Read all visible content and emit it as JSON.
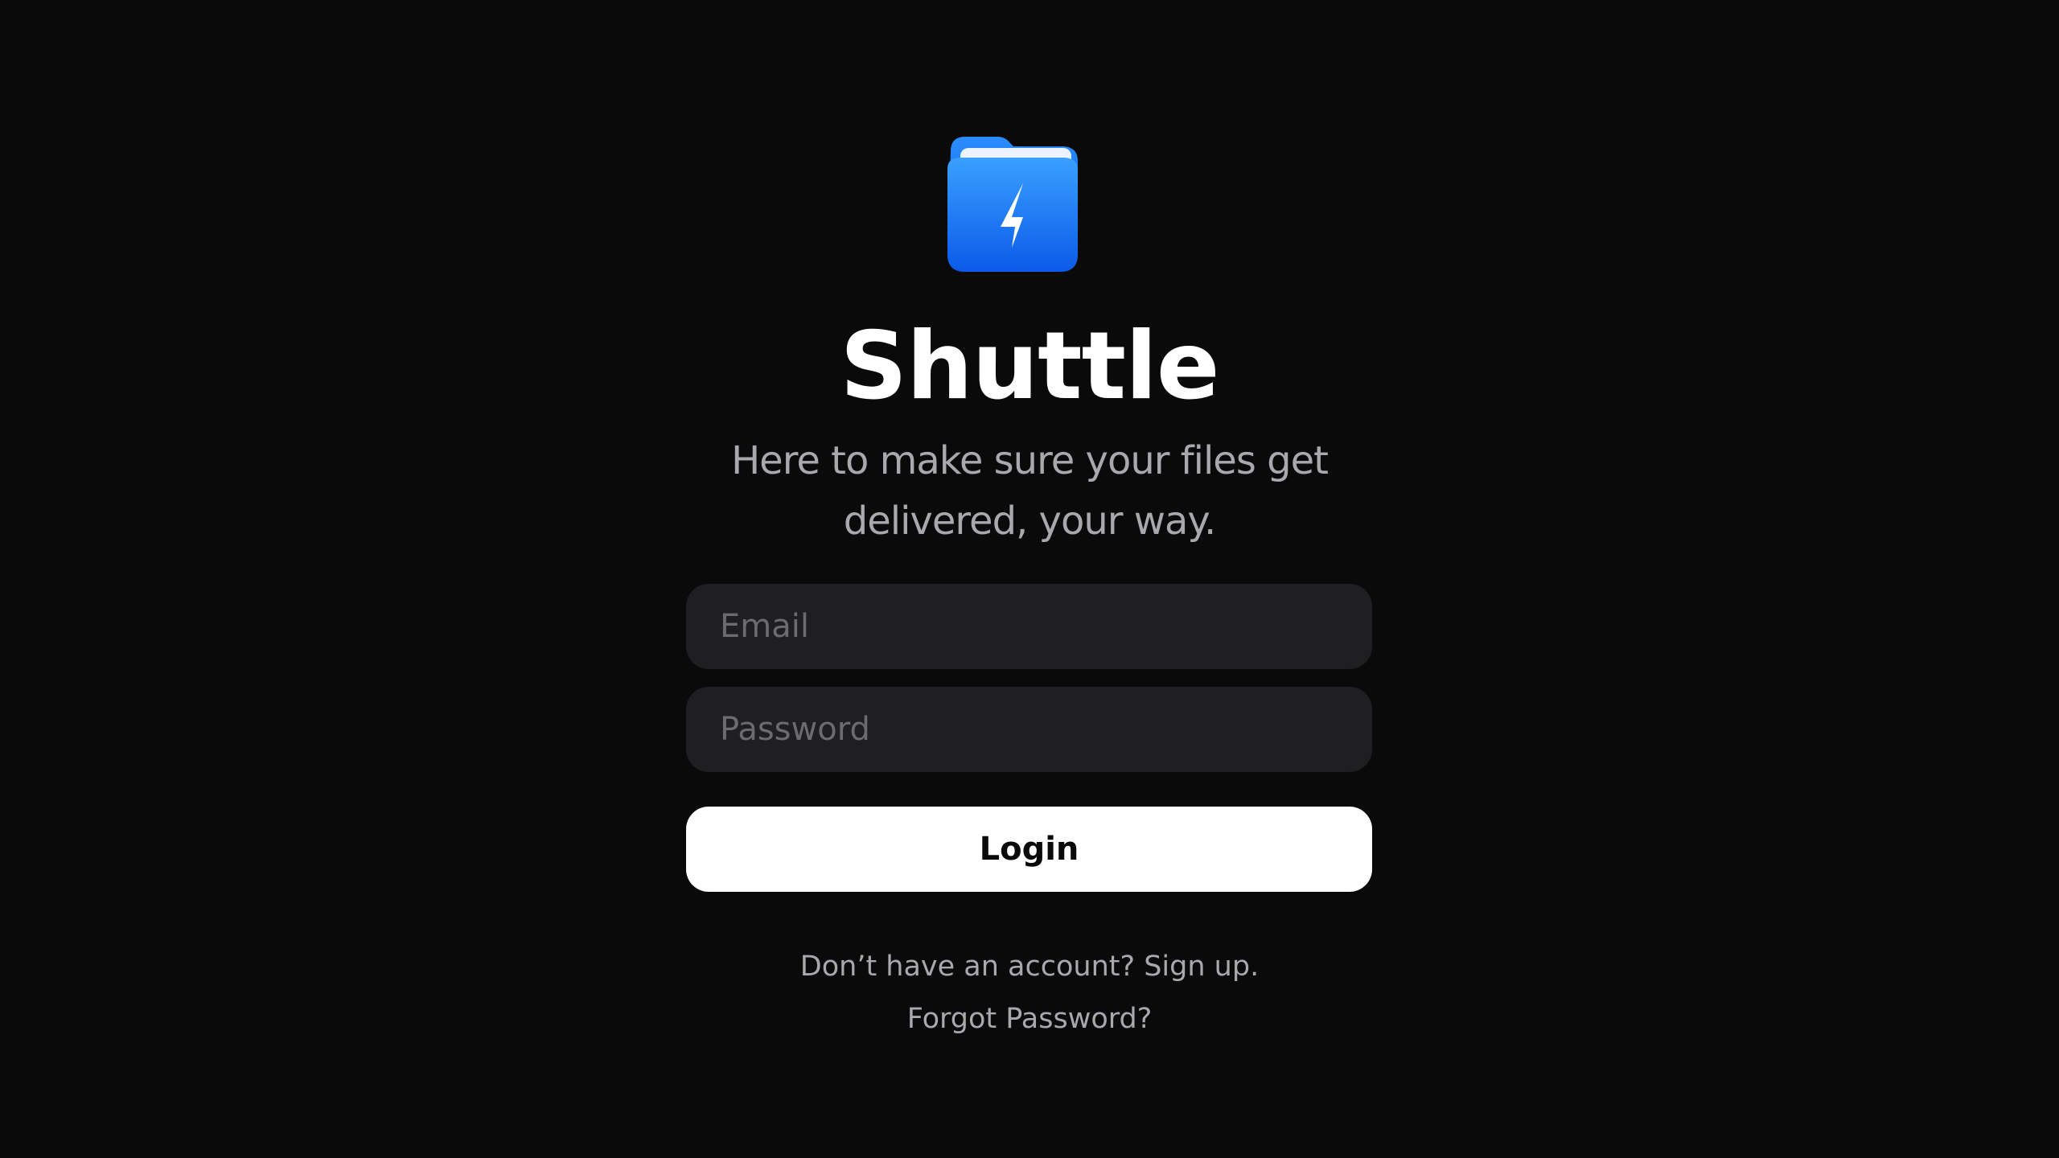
{
  "app": {
    "name": "Shuttle",
    "tagline_line1": "Here to make sure your files get",
    "tagline_line2": "delivered, your way.",
    "logo_icon": "folder-lightning-icon"
  },
  "form": {
    "email_placeholder": "Email",
    "email_value": "",
    "password_placeholder": "Password",
    "password_value": "",
    "login_label": "Login"
  },
  "links": {
    "signup": "Don’t have an account? Sign up.",
    "forgot_password": "Forgot Password?"
  },
  "colors": {
    "background": "#0a0a0b",
    "input_background": "#1f1f21",
    "button_background": "#ffffff",
    "accent_blue": "#1e7bff",
    "text_muted": "#a8a8ad",
    "placeholder": "#6c6c70"
  }
}
